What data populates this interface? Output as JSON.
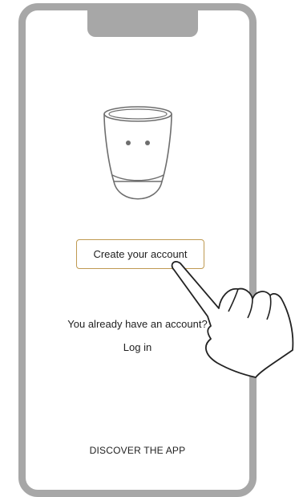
{
  "onboarding": {
    "create_account_label": "Create your account",
    "have_account_text": "You already have an account?",
    "login_label": "Log in",
    "discover_label": "DISCOVER THE APP"
  },
  "icons": {
    "device": "smart-device-icon",
    "hand": "pointing-hand-icon"
  },
  "colors": {
    "phone_frame": "#a7a7a7",
    "button_border": "#bf9a52",
    "text": "#222222"
  }
}
